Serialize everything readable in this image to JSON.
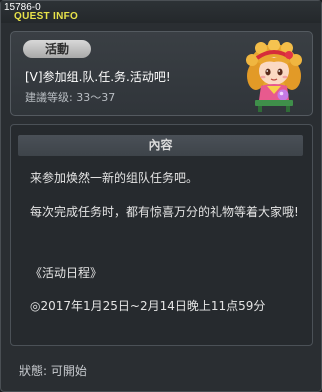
{
  "window": {
    "id_label": "15786-0",
    "title": "QUEST INFO"
  },
  "event": {
    "badge": "活動",
    "name": "[V]参加组.队.任.务.活动吧!",
    "level": "建議等级: 33〜37"
  },
  "content": {
    "header": "內容",
    "lines": [
      "来参加焕然一新的组队任务吧。",
      "每次完成任务时，都有惊喜万分的礼物等着大家哦!",
      "《活动日程》",
      "◎2017年1月25日~2月14日晚上11点59分"
    ]
  },
  "status": {
    "text": "狀態: 可開始"
  },
  "icons": {
    "portrait": "npc-portrait-icon"
  }
}
